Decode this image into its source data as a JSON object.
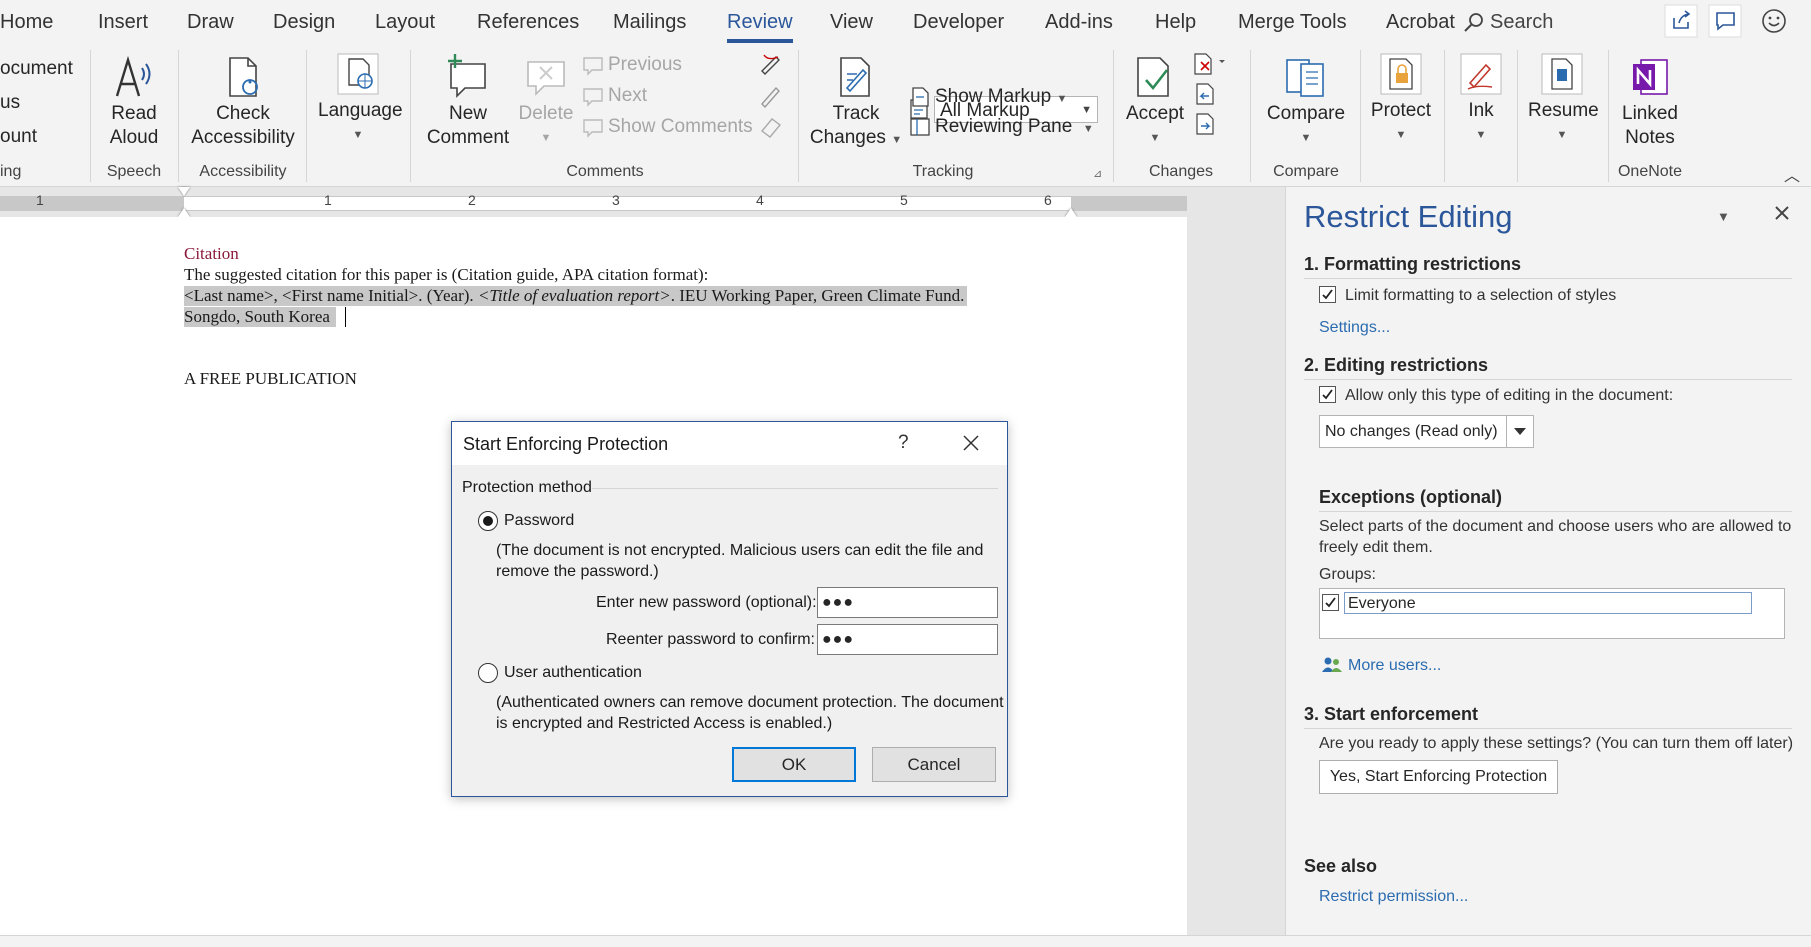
{
  "tabs": [
    {
      "label": "Home",
      "active": false
    },
    {
      "label": "Insert",
      "active": false
    },
    {
      "label": "Draw",
      "active": false
    },
    {
      "label": "Design",
      "active": false
    },
    {
      "label": "Layout",
      "active": false
    },
    {
      "label": "References",
      "active": false
    },
    {
      "label": "Mailings",
      "active": false
    },
    {
      "label": "Review",
      "active": true
    },
    {
      "label": "View",
      "active": false
    },
    {
      "label": "Developer",
      "active": false
    },
    {
      "label": "Add-ins",
      "active": false
    },
    {
      "label": "Help",
      "active": false
    },
    {
      "label": "Merge Tools",
      "active": false
    },
    {
      "label": "Acrobat",
      "active": false
    }
  ],
  "search_label": "Search",
  "ribbon": {
    "proofing_partial": [
      "ocument",
      "us",
      "ount"
    ],
    "proofing_group_partial": "ing",
    "read_aloud": [
      "Read",
      "Aloud"
    ],
    "speech_group": "Speech",
    "check_accessibility": [
      "Check",
      "Accessibility"
    ],
    "accessibility_group": "Accessibility",
    "language": "Language",
    "new_comment": [
      "New",
      "Comment"
    ],
    "delete": "Delete",
    "previous": "Previous",
    "next": "Next",
    "show_comments": "Show Comments",
    "comments_group": "Comments",
    "track_changes": [
      "Track",
      "Changes"
    ],
    "markup_selected": "All Markup",
    "show_markup": "Show Markup",
    "reviewing_pane": "Reviewing Pane",
    "tracking_group": "Tracking",
    "accept": "Accept",
    "changes_group": "Changes",
    "compare": "Compare",
    "compare_group": "Compare",
    "protect": "Protect",
    "ink": "Ink",
    "resume": "Resume",
    "linked_notes": [
      "Linked",
      "Notes"
    ],
    "onenote_group": "OneNote"
  },
  "ruler_numbers": [
    "1",
    "1",
    "2",
    "3",
    "4",
    "5",
    "6"
  ],
  "document": {
    "heading": "Citation",
    "line1": "The suggested citation for this paper is (Citation guide, APA citation format):",
    "line2_a": "<Last name>, <First name Initial>. (Year). ",
    "line2_b": "<Title of evaluation report>",
    "line2_c": ". IEU Working Paper, Green Climate Fund.",
    "line3": "Songdo, South Korea",
    "line4": "A FREE PUBLICATION"
  },
  "pane": {
    "title": "Restrict Editing",
    "section1": "1. Formatting restrictions",
    "limit_formatting": "Limit formatting to a selection of styles",
    "limit_formatting_checked": true,
    "settings_link": "Settings...",
    "section2": "2. Editing restrictions",
    "allow_only": "Allow only this type of editing in the document:",
    "allow_only_checked": true,
    "editing_type": "No changes (Read only)",
    "exceptions_heading": "Exceptions (optional)",
    "exceptions_desc_1": "Select parts of the document and choose users who are allowed to",
    "exceptions_desc_2": "freely edit them.",
    "groups_label": "Groups:",
    "group_everyone": "Everyone",
    "group_everyone_checked": true,
    "more_users": "More users...",
    "section3": "3. Start enforcement",
    "ready_text": "Are you ready to apply these settings? (You can turn them off later)",
    "start_button": "Yes, Start Enforcing Protection",
    "see_also": "See also",
    "restrict_permission": "Restrict permission..."
  },
  "dialog": {
    "title": "Start Enforcing Protection",
    "help": "?",
    "section": "Protection method",
    "password_option": "Password",
    "password_selected": true,
    "password_note_1": "(The document is not encrypted. Malicious users can edit the file and",
    "password_note_2": "remove the password.)",
    "new_password_label": "Enter new password (optional):",
    "new_password_value": "●●●",
    "confirm_label": "Reenter password to confirm:",
    "confirm_value": "●●●",
    "user_auth_option": "User authentication",
    "user_auth_note_1": "(Authenticated owners can remove document protection. The document",
    "user_auth_note_2": "is encrypted and Restricted Access is enabled.)",
    "ok": "OK",
    "cancel": "Cancel"
  },
  "colors": {
    "accent": "#2b579a",
    "link": "#2b6cb0",
    "citation_heading": "#8b1a3a",
    "selection": "#c8c8c8"
  }
}
